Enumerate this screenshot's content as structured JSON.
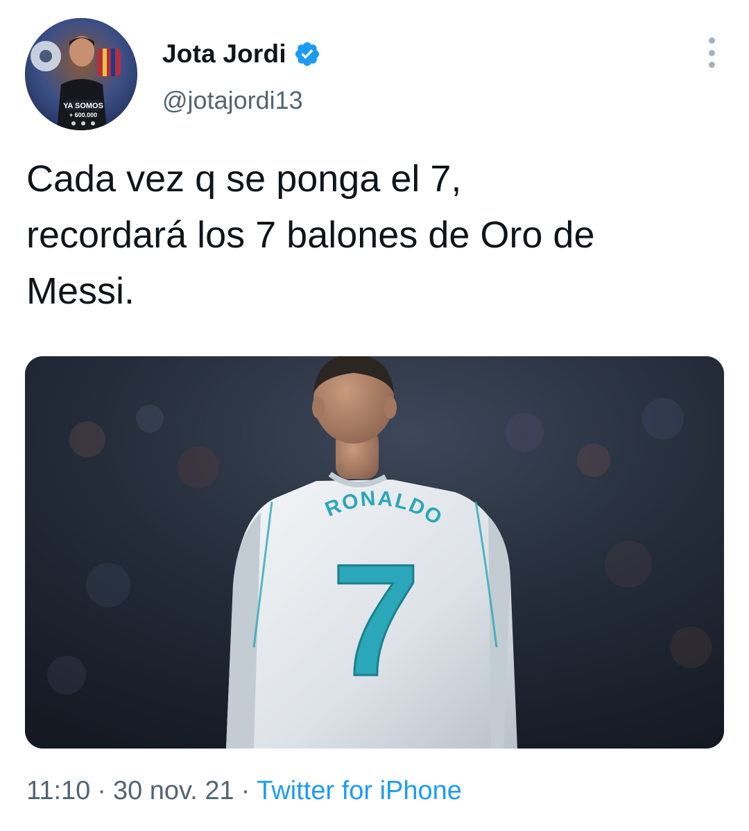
{
  "author": {
    "display_name": "Jota Jordi",
    "handle": "@jotajordi13",
    "verified": true,
    "avatar_icon": "profile-photo",
    "avatar_text_line1": "YA SOMOS",
    "avatar_text_line2": "+ 600.000"
  },
  "tweet": {
    "text": "Cada vez q se ponga el 7,\nrecordará los 7 balones de Oro de\nMessi."
  },
  "media": {
    "jersey_name": "RONALDO",
    "jersey_number": "7"
  },
  "meta": {
    "time": "11:10",
    "separator": "·",
    "date": "30 nov. 21",
    "source": "Twitter for iPhone"
  },
  "colors": {
    "verified_badge": "#1d9bf0",
    "source_link": "#1d9bf0",
    "secondary_text": "#536471",
    "jersey_accent": "#2aa7b8"
  }
}
